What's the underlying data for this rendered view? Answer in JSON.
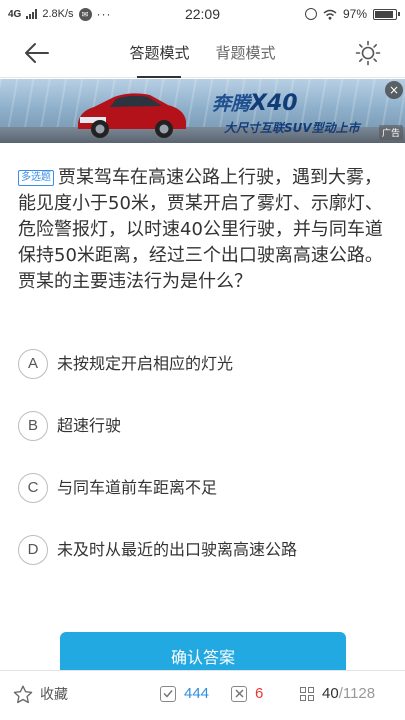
{
  "status_bar": {
    "network": "4G",
    "speed": "2.8K/s",
    "time": "22:09",
    "battery": "97%",
    "battery_level": 0.97
  },
  "header": {
    "tabs": [
      {
        "label": "答题模式",
        "active": true
      },
      {
        "label": "背题模式",
        "active": false
      }
    ]
  },
  "ad": {
    "brand": "奔腾",
    "model": "X40",
    "slogan": "大尺寸互联SUV型动上市",
    "tag": "广告",
    "close": "×"
  },
  "question": {
    "type": "多选题",
    "text": "贾某驾车在高速公路上行驶，遇到大雾，能见度小于50米，贾某开启了雾灯、示廓灯、危险警报灯，以时速40公里行驶，并与同车道保持50米距离，经过三个出口驶离高速公路。贾某的主要违法行为是什么？"
  },
  "options": [
    {
      "letter": "A",
      "text": "未按规定开启相应的灯光"
    },
    {
      "letter": "B",
      "text": "超速行驶"
    },
    {
      "letter": "C",
      "text": "与同车道前车距离不足"
    },
    {
      "letter": "D",
      "text": "未及时从最近的出口驶离高速公路"
    }
  ],
  "confirm_label": "确认答案",
  "bottom_bar": {
    "favorite_label": "收藏",
    "correct_count": "444",
    "wrong_count": "6",
    "current": "40",
    "total": "/1128"
  },
  "colors": {
    "accent": "#23a9e1",
    "correct": "#2f8fe0",
    "wrong": "#e53935"
  }
}
